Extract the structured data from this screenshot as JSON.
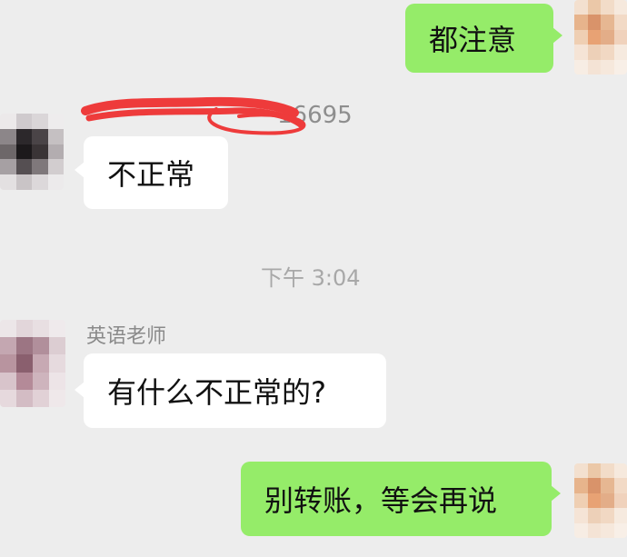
{
  "chat": {
    "messages": [
      {
        "side": "right",
        "text": "都注意"
      },
      {
        "side": "left",
        "sender": "16695",
        "text": "不正常"
      },
      {
        "type": "timestamp",
        "text": "下午 3:04"
      },
      {
        "side": "left",
        "sender": "英语老师",
        "text": "有什么不正常的?"
      },
      {
        "side": "right",
        "text": "别转账，等会再说"
      }
    ]
  },
  "colors": {
    "background": "#ededed",
    "self_bubble": "#95ec69",
    "other_bubble": "#ffffff",
    "redaction": "#ee3b3b"
  }
}
